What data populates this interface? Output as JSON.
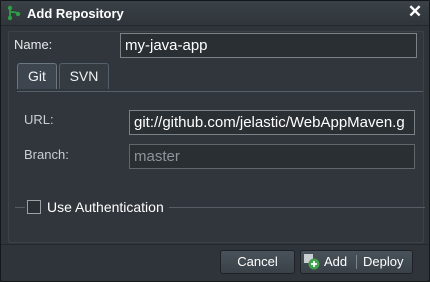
{
  "dialog": {
    "title": "Add Repository",
    "close_glyph": "✕",
    "title_icon": "git-branch-icon"
  },
  "form": {
    "name_label": "Name:",
    "name_value": "my-java-app",
    "tabs": [
      {
        "label": "Git",
        "active": true
      },
      {
        "label": "SVN",
        "active": false
      }
    ],
    "url_label": "URL:",
    "url_value": "git://github.com/jelastic/WebAppMaven.g",
    "branch_label": "Branch:",
    "branch_placeholder": "master",
    "auth_label": "Use Authentication",
    "auth_checked": false
  },
  "footer": {
    "cancel_label": "Cancel",
    "add_label": "Add",
    "deploy_label": "Deploy",
    "add_icon": "add-icon"
  },
  "colors": {
    "window_bg": "#2e3439",
    "field_bg": "#2a2f33",
    "add_icon_green": "#3ea34a"
  }
}
